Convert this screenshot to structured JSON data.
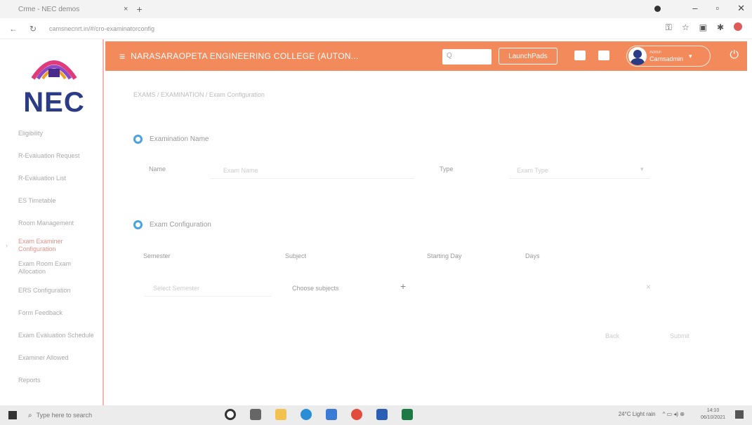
{
  "browser": {
    "tab_title": "Crme - NEC demos",
    "tab_close": "×",
    "new_tab": "+",
    "url": "camsnecnrt.in/#/cro-examinatorconfig",
    "win_min": "–",
    "win_max": "▫",
    "win_close": "✕"
  },
  "header": {
    "menu_icon": "≡",
    "college_name": "NARASARAOPETA ENGINEERING COLLEGE (AUTON...",
    "search_placeholder": "Q",
    "launch_label": "LaunchPads",
    "user_role": "Admin",
    "user_name": "Camsadmin",
    "caret": "▾",
    "power": "⏻"
  },
  "logo": {
    "text": "NEC"
  },
  "sidebar": {
    "items": [
      {
        "label": "Eligibility",
        "active": false
      },
      {
        "label": "R-Evaluation Request",
        "active": false
      },
      {
        "label": "R-Evaluation List",
        "active": false
      },
      {
        "label": "ES Timetable",
        "active": false
      },
      {
        "label": "Room Management",
        "active": false
      },
      {
        "label": "Exam Examiner Configuration",
        "active": true
      },
      {
        "label": "Exam Room Exam Allocation",
        "active": false
      },
      {
        "label": "ERS Configuration",
        "active": false
      },
      {
        "label": "Form Feedback",
        "active": false
      },
      {
        "label": "Exam Evaluation Schedule",
        "active": false
      },
      {
        "label": "Examiner Allowed",
        "active": false
      },
      {
        "label": "Reports",
        "active": false
      }
    ]
  },
  "breadcrumb": "EXAMS / EXAMINATION / Exam Configuration",
  "section1": {
    "title": "Examination Name",
    "name_label": "Name",
    "name_placeholder": "Exam Name",
    "type_label": "Type",
    "type_placeholder": "Exam Type"
  },
  "section2": {
    "title": "Exam Configuration",
    "col_semester": "Semester",
    "col_subject": "Subject",
    "col_starting_day": "Starting Day",
    "col_days": "Days",
    "semester_placeholder": "Select Semester",
    "subject_placeholder": "Choose subjects",
    "add": "+",
    "remove": "×",
    "back_button": "Back",
    "submit_button": "Submit"
  },
  "taskbar": {
    "search_icon": "⌕",
    "search_placeholder": "Type here to search",
    "weather": "24°C Light rain",
    "tray_icons": "^  ▭  ◂)  ⊕",
    "time": "14:10",
    "date": "06/10/2021"
  },
  "colors": {
    "header": "#f28a5c",
    "logo_text": "#2c3b85",
    "section_icon": "#4aa3df",
    "active_nav": "#e8918a"
  }
}
